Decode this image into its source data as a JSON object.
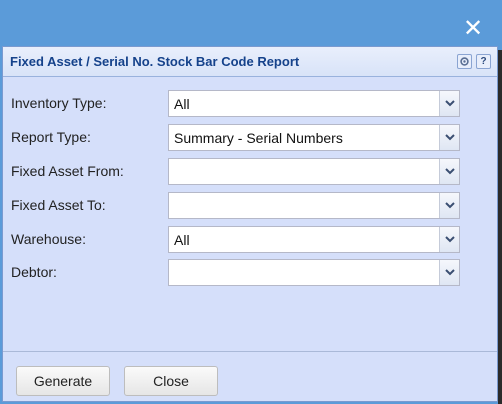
{
  "window": {
    "close_icon": "close-icon"
  },
  "dialog": {
    "title": "Fixed Asset / Serial No. Stock Bar Code Report",
    "tools": {
      "gear_icon": "gear-icon",
      "help_label": "?"
    }
  },
  "form": {
    "fields": [
      {
        "label": "Inventory Type:",
        "value": "All"
      },
      {
        "label": "Report Type:",
        "value": "Summary - Serial Numbers"
      },
      {
        "label": "Fixed Asset From:",
        "value": ""
      },
      {
        "label": "Fixed Asset To:",
        "value": ""
      },
      {
        "label": "Warehouse:",
        "value": "All"
      },
      {
        "label": "Debtor:",
        "value": ""
      }
    ]
  },
  "footer": {
    "generate_label": "Generate",
    "close_label": "Close"
  },
  "colors": {
    "backdrop": "#5b9bd9",
    "dialog_bg": "#d5dffa",
    "title_text": "#15428b"
  }
}
